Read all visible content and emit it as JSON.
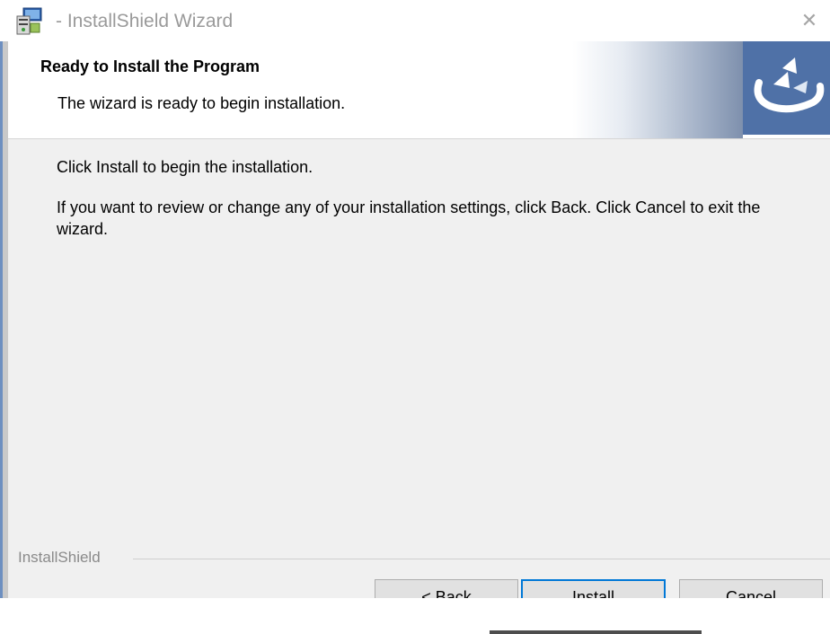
{
  "window": {
    "title": "- InstallShield Wizard",
    "app_icon": "installer-icon",
    "close_symbol": "✕"
  },
  "header": {
    "title": "Ready to Install the Program",
    "subtitle": "The wizard is ready to begin installation.",
    "logo_icon": "installshield-logo-icon",
    "logo_color": "#4f71a7"
  },
  "body": {
    "line1": "Click Install to begin the installation.",
    "line2": "If you want to review or change any of your installation settings, click Back. Click Cancel to exit the wizard."
  },
  "footer": {
    "brand": "InstallShield",
    "buttons": {
      "back": "< Back",
      "install": "Install",
      "cancel": "Cancel"
    }
  }
}
